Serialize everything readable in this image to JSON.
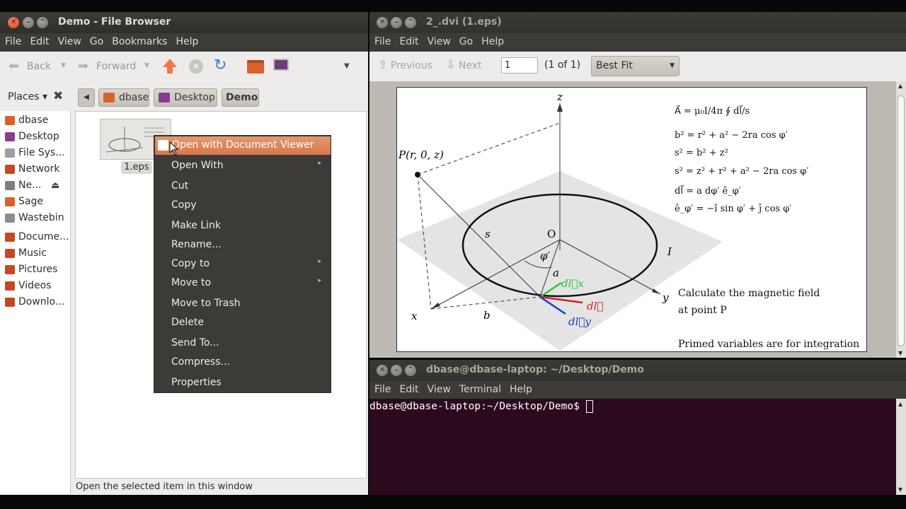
{
  "file_browser": {
    "title": "Demo - File Browser",
    "menu": [
      "File",
      "Edit",
      "View",
      "Go",
      "Bookmarks",
      "Help"
    ],
    "toolbar": {
      "back": "Back",
      "forward": "Forward"
    },
    "places_label": "Places",
    "breadcrumbs": [
      "dbase",
      "Desktop",
      "Demo"
    ],
    "sidebar": [
      "dbase",
      "Desktop",
      "File Sys...",
      "Network",
      "Ne...",
      "Sage",
      "Wastebin",
      "Docume...",
      "Music",
      "Pictures",
      "Videos",
      "Downlo..."
    ],
    "file_name": "1.eps",
    "status": "Open the selected item in this window",
    "context_menu": [
      "Open with Document Viewer",
      "Open With",
      "Cut",
      "Copy",
      "Make Link",
      "Rename...",
      "Copy to",
      "Move to",
      "Move to Trash",
      "Delete",
      "Send To...",
      "Compress...",
      "Properties"
    ]
  },
  "viewer": {
    "title": "2_.dvi (1.eps)",
    "menu": [
      "File",
      "Edit",
      "View",
      "Go",
      "Help"
    ],
    "previous": "Previous",
    "next": "Next",
    "page": "1",
    "page_of": "(1 of 1)",
    "zoom": "Best Fit",
    "figure": {
      "axis_z": "z",
      "axis_x": "x",
      "axis_y": "y",
      "point_label": "P(r, 0, z)",
      "origin": "O",
      "s": "s",
      "a": "a",
      "b": "b",
      "phi": "φ′",
      "current": "I",
      "dlx": "dl⃗x",
      "dl": "dl⃗",
      "dly": "dl⃗y",
      "equations": [
        "A⃗ = μ₀I/4π ∮ dl⃗/s",
        "b² = r² + a² − 2ra cos φ′",
        "s² = b² + z²",
        "s² = z² + r² + a² − 2ra cos φ′",
        "dl⃗ = a dφ′ ê_φ′",
        "ê_φ′ = −î sin φ′ + ĵ cos φ′"
      ],
      "note1": "Calculate the magnetic field",
      "note2": "at point P",
      "note3": "Primed variables are for integration"
    }
  },
  "terminal": {
    "title": "dbase@dbase-laptop: ~/Desktop/Demo",
    "menu": [
      "File",
      "Edit",
      "View",
      "Terminal",
      "Help"
    ],
    "prompt": "dbase@dbase-laptop:~/Desktop/Demo$ "
  },
  "colors": {
    "accent": "#f07746",
    "terminal_bg": "#2c0a1e",
    "titlebar": "#3c3b37"
  }
}
